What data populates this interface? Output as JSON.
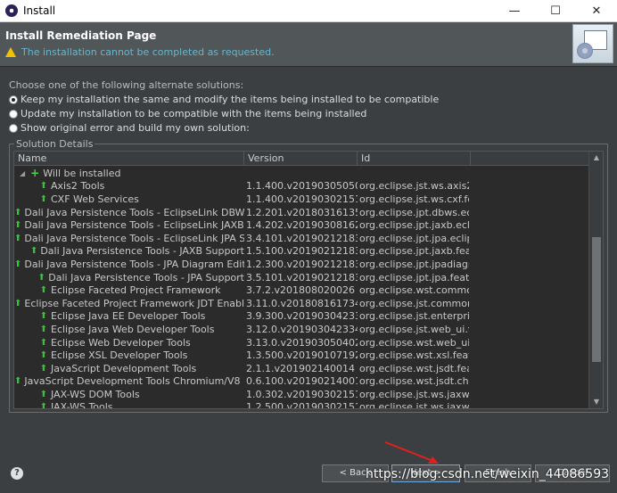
{
  "window": {
    "title": "Install",
    "min": "—",
    "max": "☐",
    "close": "✕"
  },
  "header": {
    "title": "Install Remediation Page",
    "warning": "The installation cannot be completed as requested."
  },
  "options": {
    "label": "Choose one of the following alternate solutions:",
    "items": [
      {
        "label": "Keep my installation the same and modify the items being installed to be compatible",
        "selected": true
      },
      {
        "label": "Update my installation to be compatible with the items being installed",
        "selected": false
      },
      {
        "label": "Show original error and build my own solution:",
        "selected": false
      }
    ]
  },
  "details": {
    "legend": "Solution Details",
    "columns": [
      "Name",
      "Version",
      "Id"
    ],
    "root": "Will be installed",
    "rows": [
      {
        "name": "Axis2 Tools",
        "version": "1.1.400.v201903050508",
        "id": "org.eclipse.jst.ws.axis2tools..."
      },
      {
        "name": "CXF Web Services",
        "version": "1.1.400.v201903021515",
        "id": "org.eclipse.jst.ws.cxf.feature..."
      },
      {
        "name": "Dali Java Persistence Tools - EclipseLink DBWS Sup",
        "version": "1.2.201.v201803161350",
        "id": "org.eclipse.jpt.dbws.eclipse..."
      },
      {
        "name": "Dali Java Persistence Tools - EclipseLink JAXB Supp",
        "version": "1.4.202.v201903081623",
        "id": "org.eclipse.jpt.jaxb.eclipseli..."
      },
      {
        "name": "Dali Java Persistence Tools - EclipseLink JPA Suppo",
        "version": "3.4.101.v201902121834",
        "id": "org.eclipse.jpt.jpa.eclipselin..."
      },
      {
        "name": "Dali Java Persistence Tools - JAXB Support",
        "version": "1.5.100.v201902121834",
        "id": "org.eclipse.jpt.jaxb.feature.f..."
      },
      {
        "name": "Dali Java Persistence Tools - JPA Diagram Editor",
        "version": "1.2.300.v201902121834",
        "id": "org.eclipse.jpt.jpadiagrame..."
      },
      {
        "name": "Dali Java Persistence Tools - JPA Support",
        "version": "3.5.101.v201902121834",
        "id": "org.eclipse.jpt.jpa.feature.fe..."
      },
      {
        "name": "Eclipse Faceted Project Framework",
        "version": "3.7.2.v201808020026",
        "id": "org.eclipse.wst.common.fpr..."
      },
      {
        "name": "Eclipse Faceted Project Framework JDT Enablemen",
        "version": "3.11.0.v201808161734",
        "id": "org.eclipse.jst.common.fpro..."
      },
      {
        "name": "Eclipse Java EE Developer Tools",
        "version": "3.9.300.v201903042334",
        "id": "org.eclipse.jst.enterprise_ui..."
      },
      {
        "name": "Eclipse Java Web Developer Tools",
        "version": "3.12.0.v201903042334",
        "id": "org.eclipse.jst.web_ui.featur..."
      },
      {
        "name": "Eclipse Web Developer Tools",
        "version": "3.13.0.v201903050402",
        "id": "org.eclipse.wst.web_ui.featu..."
      },
      {
        "name": "Eclipse XSL Developer Tools",
        "version": "1.3.500.v201901071922",
        "id": "org.eclipse.wst.xsl.feature.fe..."
      },
      {
        "name": "JavaScript Development Tools",
        "version": "2.1.1.v201902140014",
        "id": "org.eclipse.wst.jsdt.feature.f..."
      },
      {
        "name": "JavaScript Development Tools Chromium/V8 Remo",
        "version": "0.6.100.v201902140014",
        "id": "org.eclipse.wst.jsdt.chromiu..."
      },
      {
        "name": "JAX-WS DOM Tools",
        "version": "1.0.302.v201903021515",
        "id": "org.eclipse.jst.ws.jaxws.dom..."
      },
      {
        "name": "JAX-WS Tools",
        "version": "1.2.500.v201903021515",
        "id": "org.eclipse.jst.ws.jaxws.feat..."
      }
    ]
  },
  "buttons": {
    "back": "< Back",
    "next": "Next >",
    "finish": "Finish",
    "cancel": "Cancel",
    "help": "?"
  },
  "watermark": "https://blog.csdn.net/weixin_44086593"
}
